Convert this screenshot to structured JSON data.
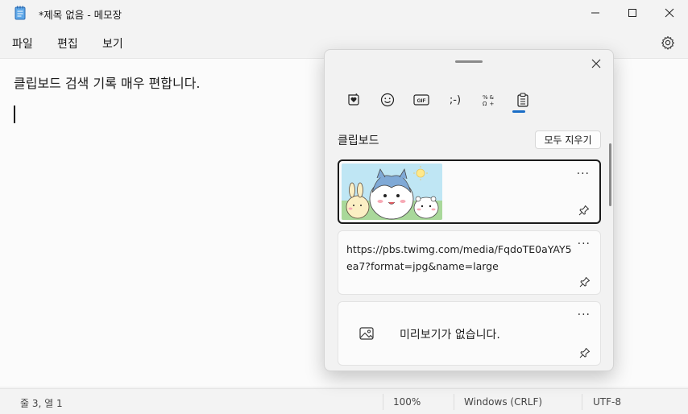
{
  "window": {
    "title": "*제목 없음 - 메모장",
    "minimize_icon": "minimize-icon",
    "maximize_icon": "maximize-icon",
    "close_icon": "close-icon"
  },
  "menu": {
    "items": [
      {
        "label": "파일"
      },
      {
        "label": "편집"
      },
      {
        "label": "보기"
      }
    ],
    "settings_icon": "gear-icon"
  },
  "editor": {
    "text": "클립보드 검색 기록 매우 편합니다."
  },
  "statusbar": {
    "position": "줄 3, 열 1",
    "zoom": "100%",
    "line_ending": "Windows (CRLF)",
    "encoding": "UTF-8"
  },
  "clipboard_panel": {
    "tabs": [
      {
        "name": "kaomoji-heart-icon"
      },
      {
        "name": "emoji-icon"
      },
      {
        "label": "GIF"
      },
      {
        "label": ";-)"
      },
      {
        "name": "symbols-icon"
      },
      {
        "name": "clipboard-icon",
        "active": true
      }
    ],
    "section_title": "클립보드",
    "clear_all_label": "모두 지우기",
    "more_label": "···",
    "items": [
      {
        "type": "image",
        "selected": true
      },
      {
        "type": "text",
        "text": "https://pbs.twimg.com/media/FqdoTE0aYAY5ea7?format=jpg&name=large"
      },
      {
        "type": "no-preview",
        "text": "미리보기가 없습니다."
      }
    ],
    "accent_color": "#1a6dc6"
  }
}
